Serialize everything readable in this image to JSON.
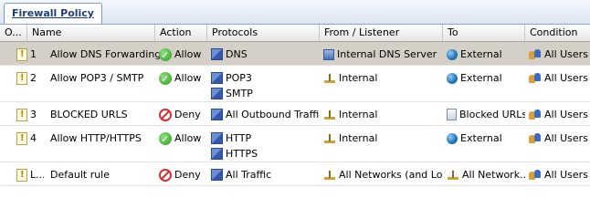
{
  "tab_label": "Firewall Policy",
  "columns": [
    "O...",
    "Name",
    "Action",
    "Protocols",
    "From / Listener",
    "To",
    "Condition"
  ],
  "rows": [
    {
      "order": "1",
      "name": "Allow DNS Forwarding",
      "action": "Allow",
      "action_icon": "allow-icon",
      "protocols": [
        "DNS"
      ],
      "from": "Internal DNS Server",
      "from_icon": "server-icon",
      "to": "External",
      "to_icon": "globe-icon",
      "condition": "All Users",
      "selected": true,
      "expandable": false
    },
    {
      "order": "2",
      "name": "Allow POP3 / SMTP",
      "action": "Allow",
      "action_icon": "allow-icon",
      "protocols": [
        "POP3",
        "SMTP"
      ],
      "from": "Internal",
      "from_icon": "network-icon",
      "to": "External",
      "to_icon": "globe-icon",
      "condition": "All Users",
      "selected": false,
      "expandable": true
    },
    {
      "order": "3",
      "name": "BLOCKED  URLS",
      "action": "Deny",
      "action_icon": "deny-icon",
      "protocols": [
        "All Outbound Traffic"
      ],
      "from": "Internal",
      "from_icon": "network-icon",
      "to": "Blocked URLs",
      "to_icon": "blocked-urls-icon",
      "condition": "All Users",
      "selected": false,
      "expandable": false
    },
    {
      "order": "4",
      "name": "Allow HTTP/HTTPS",
      "action": "Allow",
      "action_icon": "allow-icon",
      "protocols": [
        "HTTP",
        "HTTPS"
      ],
      "from": "Internal",
      "from_icon": "network-icon",
      "to": "External",
      "to_icon": "globe-icon",
      "condition": "All Users",
      "selected": false,
      "expandable": true
    },
    {
      "order": "L...",
      "name": "Default rule",
      "action": "Deny",
      "action_icon": "deny-icon",
      "protocols": [
        "All Traffic"
      ],
      "from": "All Networks (and Lo...",
      "from_icon": "network-icon",
      "to": "All Network...",
      "to_icon": "network-icon",
      "condition": "All Users",
      "selected": false,
      "expandable": false
    }
  ],
  "colors": {
    "selected_row": "#d4d0c8",
    "tab_text": "#1f3d7a",
    "header_bg": "#e6e6e6"
  }
}
